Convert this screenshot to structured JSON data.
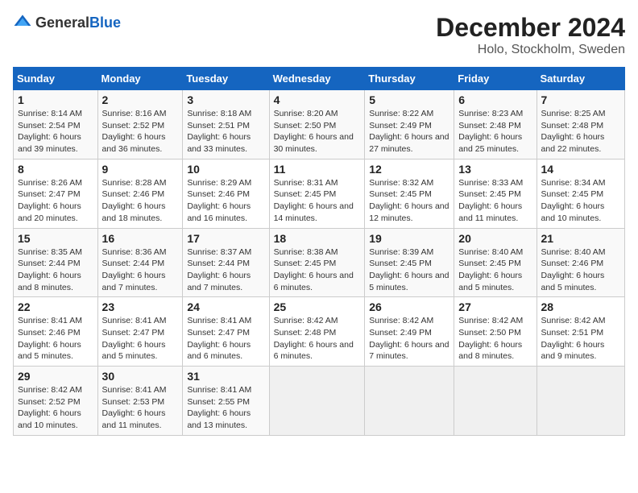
{
  "header": {
    "logo_general": "General",
    "logo_blue": "Blue",
    "month": "December 2024",
    "location": "Holo, Stockholm, Sweden"
  },
  "weekdays": [
    "Sunday",
    "Monday",
    "Tuesday",
    "Wednesday",
    "Thursday",
    "Friday",
    "Saturday"
  ],
  "weeks": [
    [
      {
        "day": 1,
        "info": "Sunrise: 8:14 AM\nSunset: 2:54 PM\nDaylight: 6 hours and 39 minutes."
      },
      {
        "day": 2,
        "info": "Sunrise: 8:16 AM\nSunset: 2:52 PM\nDaylight: 6 hours and 36 minutes."
      },
      {
        "day": 3,
        "info": "Sunrise: 8:18 AM\nSunset: 2:51 PM\nDaylight: 6 hours and 33 minutes."
      },
      {
        "day": 4,
        "info": "Sunrise: 8:20 AM\nSunset: 2:50 PM\nDaylight: 6 hours and 30 minutes."
      },
      {
        "day": 5,
        "info": "Sunrise: 8:22 AM\nSunset: 2:49 PM\nDaylight: 6 hours and 27 minutes."
      },
      {
        "day": 6,
        "info": "Sunrise: 8:23 AM\nSunset: 2:48 PM\nDaylight: 6 hours and 25 minutes."
      },
      {
        "day": 7,
        "info": "Sunrise: 8:25 AM\nSunset: 2:48 PM\nDaylight: 6 hours and 22 minutes."
      }
    ],
    [
      {
        "day": 8,
        "info": "Sunrise: 8:26 AM\nSunset: 2:47 PM\nDaylight: 6 hours and 20 minutes."
      },
      {
        "day": 9,
        "info": "Sunrise: 8:28 AM\nSunset: 2:46 PM\nDaylight: 6 hours and 18 minutes."
      },
      {
        "day": 10,
        "info": "Sunrise: 8:29 AM\nSunset: 2:46 PM\nDaylight: 6 hours and 16 minutes."
      },
      {
        "day": 11,
        "info": "Sunrise: 8:31 AM\nSunset: 2:45 PM\nDaylight: 6 hours and 14 minutes."
      },
      {
        "day": 12,
        "info": "Sunrise: 8:32 AM\nSunset: 2:45 PM\nDaylight: 6 hours and 12 minutes."
      },
      {
        "day": 13,
        "info": "Sunrise: 8:33 AM\nSunset: 2:45 PM\nDaylight: 6 hours and 11 minutes."
      },
      {
        "day": 14,
        "info": "Sunrise: 8:34 AM\nSunset: 2:45 PM\nDaylight: 6 hours and 10 minutes."
      }
    ],
    [
      {
        "day": 15,
        "info": "Sunrise: 8:35 AM\nSunset: 2:44 PM\nDaylight: 6 hours and 8 minutes."
      },
      {
        "day": 16,
        "info": "Sunrise: 8:36 AM\nSunset: 2:44 PM\nDaylight: 6 hours and 7 minutes."
      },
      {
        "day": 17,
        "info": "Sunrise: 8:37 AM\nSunset: 2:44 PM\nDaylight: 6 hours and 7 minutes."
      },
      {
        "day": 18,
        "info": "Sunrise: 8:38 AM\nSunset: 2:45 PM\nDaylight: 6 hours and 6 minutes."
      },
      {
        "day": 19,
        "info": "Sunrise: 8:39 AM\nSunset: 2:45 PM\nDaylight: 6 hours and 5 minutes."
      },
      {
        "day": 20,
        "info": "Sunrise: 8:40 AM\nSunset: 2:45 PM\nDaylight: 6 hours and 5 minutes."
      },
      {
        "day": 21,
        "info": "Sunrise: 8:40 AM\nSunset: 2:46 PM\nDaylight: 6 hours and 5 minutes."
      }
    ],
    [
      {
        "day": 22,
        "info": "Sunrise: 8:41 AM\nSunset: 2:46 PM\nDaylight: 6 hours and 5 minutes."
      },
      {
        "day": 23,
        "info": "Sunrise: 8:41 AM\nSunset: 2:47 PM\nDaylight: 6 hours and 5 minutes."
      },
      {
        "day": 24,
        "info": "Sunrise: 8:41 AM\nSunset: 2:47 PM\nDaylight: 6 hours and 6 minutes."
      },
      {
        "day": 25,
        "info": "Sunrise: 8:42 AM\nSunset: 2:48 PM\nDaylight: 6 hours and 6 minutes."
      },
      {
        "day": 26,
        "info": "Sunrise: 8:42 AM\nSunset: 2:49 PM\nDaylight: 6 hours and 7 minutes."
      },
      {
        "day": 27,
        "info": "Sunrise: 8:42 AM\nSunset: 2:50 PM\nDaylight: 6 hours and 8 minutes."
      },
      {
        "day": 28,
        "info": "Sunrise: 8:42 AM\nSunset: 2:51 PM\nDaylight: 6 hours and 9 minutes."
      }
    ],
    [
      {
        "day": 29,
        "info": "Sunrise: 8:42 AM\nSunset: 2:52 PM\nDaylight: 6 hours and 10 minutes."
      },
      {
        "day": 30,
        "info": "Sunrise: 8:41 AM\nSunset: 2:53 PM\nDaylight: 6 hours and 11 minutes."
      },
      {
        "day": 31,
        "info": "Sunrise: 8:41 AM\nSunset: 2:55 PM\nDaylight: 6 hours and 13 minutes."
      },
      null,
      null,
      null,
      null
    ]
  ]
}
